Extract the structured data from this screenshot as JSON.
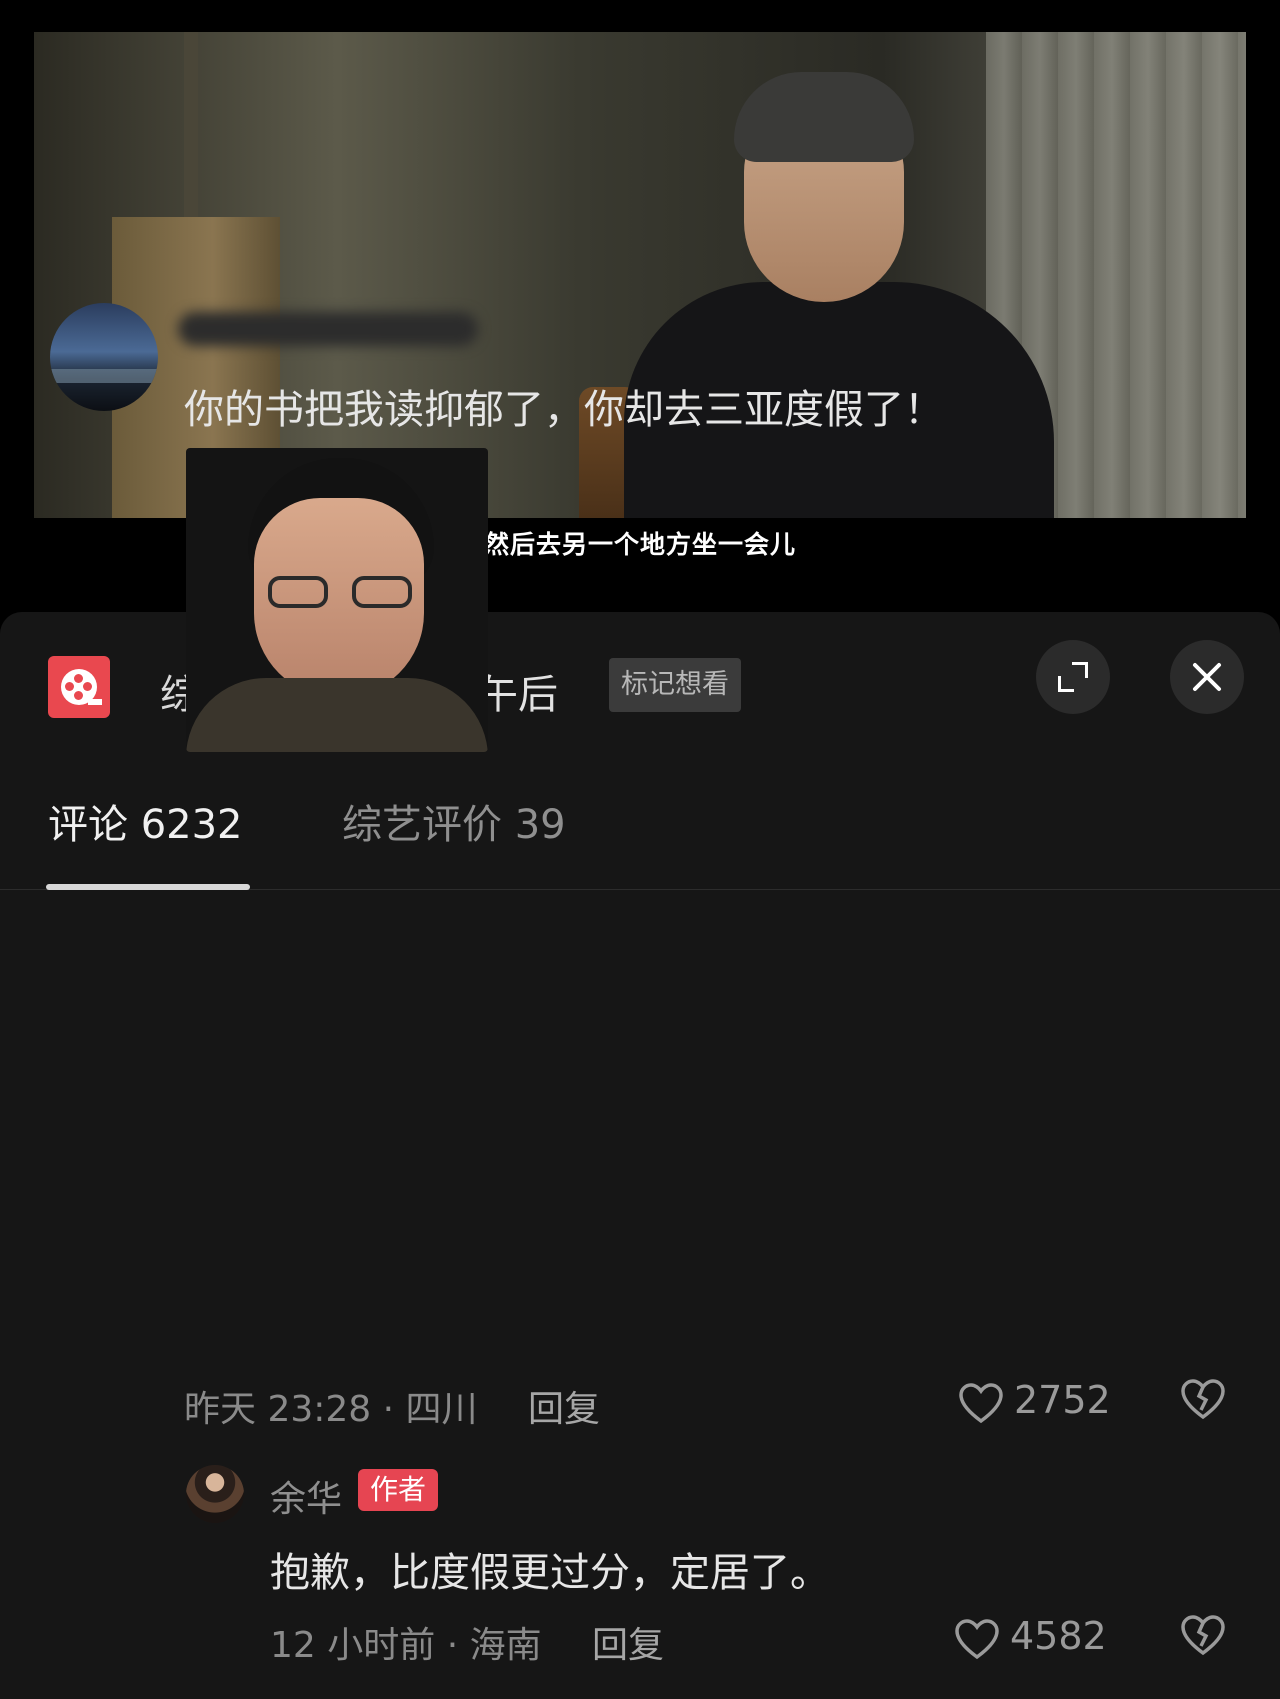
{
  "video": {
    "subtitle": "然后去另一个地方坐一会儿"
  },
  "header": {
    "category": "综艺",
    "show_title": "一个文学的午后",
    "mark_label": "标记想看",
    "icons": {
      "app": "film-reel-icon",
      "expand": "expand-icon",
      "close": "close-icon"
    },
    "app_icon_color": "#e9484f"
  },
  "tabs": [
    {
      "label": "评论 6232",
      "active": true
    },
    {
      "label": "综艺评价 39",
      "active": false
    }
  ],
  "comments": [
    {
      "text": "你的书把我读抑郁了，你却去三亚度假了！",
      "meta": "昨天 23:28 · 四川",
      "reply_label": "回复",
      "likes": "2752",
      "has_sticker": true,
      "replies": [
        {
          "author": "余华",
          "badge": "作者",
          "text": "抱歉，比度假更过分，定居了。",
          "meta": "12 小时前 · 海南",
          "reply_label": "回复",
          "likes": "4582"
        }
      ]
    }
  ],
  "colors": {
    "background": "#000000",
    "sheet": "#161616",
    "badge": "#e64552"
  }
}
